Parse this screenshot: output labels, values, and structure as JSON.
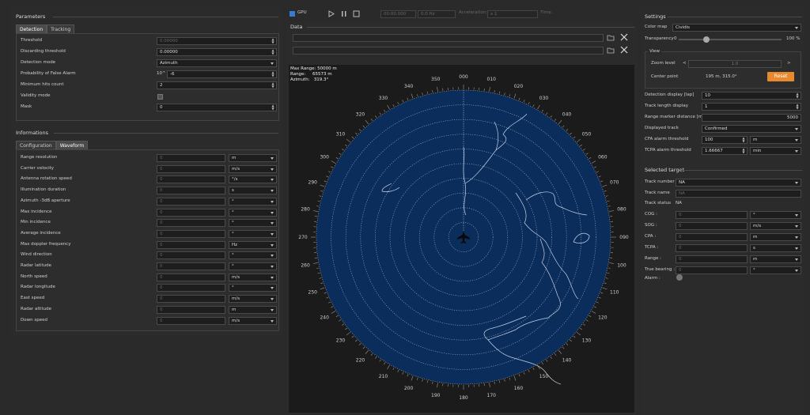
{
  "left": {
    "parameters_title": "Parameters",
    "tabs": [
      "Detection",
      "Tracking"
    ],
    "detection": [
      {
        "label": "Threshold",
        "value": "0.00000",
        "type": "spin",
        "disabled": true
      },
      {
        "label": "Discarding threshold",
        "value": "0.00000",
        "type": "spin"
      },
      {
        "label": "Detection mode",
        "value": "Azimuth",
        "type": "select"
      },
      {
        "label": "Probability of False Alarm",
        "prefix": "10^",
        "value": "-6",
        "type": "spin"
      },
      {
        "label": "Minimum hits count",
        "value": "2",
        "type": "spin"
      },
      {
        "label": "Validity mode",
        "type": "check"
      },
      {
        "label": "Mask",
        "value": "0",
        "type": "spin"
      }
    ],
    "info_title": "Informations",
    "info_tabs": [
      "Configuration",
      "Waveform"
    ],
    "info_rows": [
      {
        "label": "Range resolution",
        "value": "0",
        "unit": "m"
      },
      {
        "label": "Carrier velocity",
        "value": "0",
        "unit": "m/s"
      },
      {
        "label": "Antenna rotation speed",
        "value": "0",
        "unit": "°/s"
      },
      {
        "label": "Illumination duration",
        "value": "0",
        "unit": "s"
      },
      {
        "label": "Azimuth -3dB aperture",
        "value": "0",
        "unit": "°"
      },
      {
        "label": "Max incidence",
        "value": "0",
        "unit": "°"
      },
      {
        "label": "Min incidence",
        "value": "0",
        "unit": "°"
      },
      {
        "label": "Average incidence",
        "value": "0",
        "unit": "°"
      },
      {
        "label": "Max doppler frequency",
        "value": "0",
        "unit": "Hz"
      },
      {
        "label": "Wind direction",
        "value": "0",
        "unit": "°"
      },
      {
        "label": "Radar latitude",
        "value": "0",
        "unit": "°"
      },
      {
        "label": "North speed",
        "value": "0",
        "unit": "m/s"
      },
      {
        "label": "Radar longitude",
        "value": "0",
        "unit": "°"
      },
      {
        "label": "East speed",
        "value": "0",
        "unit": "m/s"
      },
      {
        "label": "Radar altitude",
        "value": "0",
        "unit": "m"
      },
      {
        "label": "Down speed",
        "value": "0",
        "unit": "m/s"
      }
    ]
  },
  "toolbar": {
    "gpu_label": "GPU",
    "time_field": "00:00.000",
    "freq_field": "0.0 Hz",
    "accel_label": "Acceleration:",
    "accel_value": "x 1",
    "time_label": "Time:"
  },
  "data": {
    "title": "Data"
  },
  "radar": {
    "max_range": "Max Range: 50000 m",
    "range": "Range:     65573 m",
    "azimuth": "Azimuth:   319.3°",
    "bearings": [
      "000",
      "010",
      "020",
      "030",
      "040",
      "050",
      "060",
      "070",
      "080",
      "090",
      "100",
      "110",
      "120",
      "130",
      "140",
      "150",
      "160",
      "170",
      "180",
      "190",
      "200",
      "210",
      "220",
      "230",
      "240",
      "250",
      "260",
      "270",
      "280",
      "290",
      "300",
      "310",
      "320",
      "330",
      "340",
      "350"
    ],
    "bg_color": "#0b2d5b",
    "ring_count": 10
  },
  "right": {
    "settings_title": "Settings",
    "color_map_label": "Color map",
    "color_map_value": "Cividis",
    "transparency_label": "Transparency",
    "transparency_min": "0",
    "transparency_max": "100 %",
    "transparency_value": 0.27,
    "view_title": "View",
    "zoom_label": "Zoom level",
    "zoom_value": "1.0",
    "center_label": "Center point",
    "center_value": "195 m, 315.0°",
    "reset_label": "Reset",
    "rows": [
      {
        "label": "Detection display [lap]",
        "value": "10",
        "type": "spin"
      },
      {
        "label": "Track length display",
        "value": "1",
        "type": "spin"
      },
      {
        "label": "Range marker distance [m]",
        "value": "5000",
        "type": "spin-right"
      },
      {
        "label": "Displayed track",
        "value": "Confirmed",
        "type": "select"
      },
      {
        "label": "CFA alarm threshold",
        "value": "100",
        "unit": "m"
      },
      {
        "label": "TCPA alarm threshold",
        "value": "1.66667",
        "unit": "min"
      }
    ],
    "selected_title": "Selected target",
    "track_number_label": "Track number",
    "track_number_value": "NA",
    "track_name_label": "Track name",
    "track_name_value": "NA",
    "track_status_label": "Track status",
    "track_status_value": "NA",
    "target_rows": [
      {
        "label": "COG :",
        "value": "0",
        "unit": "°"
      },
      {
        "label": "SOG :",
        "value": "0",
        "unit": "m/s"
      },
      {
        "label": "CPA :",
        "value": "0",
        "unit": "m"
      },
      {
        "label": "TCPA :",
        "value": "0",
        "unit": "s"
      },
      {
        "label": "Range :",
        "value": "0",
        "unit": "m"
      },
      {
        "label": "True bearing :",
        "value": "0",
        "unit": "°"
      }
    ],
    "alarm_label": "Alarm :",
    "accent": "#e8892e"
  }
}
